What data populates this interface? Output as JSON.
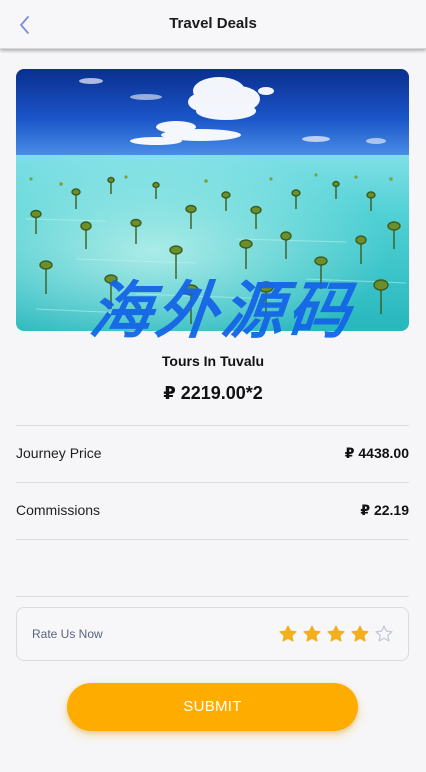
{
  "header": {
    "title": "Travel Deals",
    "back_icon": "chevron-left-icon"
  },
  "tour": {
    "name": "Tours In Tuvalu",
    "price": "₽ 2219.00*2"
  },
  "watermark": "海外源码",
  "details": [
    {
      "label": "Journey Price",
      "value": "₽ 4438.00"
    },
    {
      "label": "Commissions",
      "value": "₽ 22.19"
    }
  ],
  "rating": {
    "label": "Rate Us Now",
    "value": 4,
    "max": 5
  },
  "submit_label": "SUBMIT",
  "colors": {
    "accent": "#ffac00",
    "star_filled": "#f4b01b",
    "star_empty": "#c3c8d8",
    "back_icon": "#7b8fd6"
  }
}
